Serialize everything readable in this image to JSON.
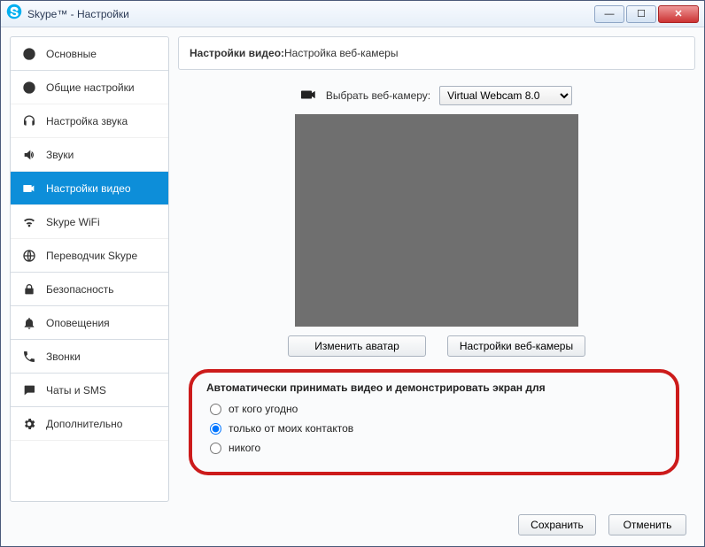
{
  "window": {
    "title": "Skype™ - Настройки"
  },
  "sidebar": {
    "items": [
      {
        "label": "Основные"
      },
      {
        "label": "Общие настройки"
      },
      {
        "label": "Настройка звука"
      },
      {
        "label": "Звуки"
      },
      {
        "label": "Настройки видео"
      },
      {
        "label": "Skype WiFi"
      },
      {
        "label": "Переводчик Skype"
      },
      {
        "label": "Безопасность"
      },
      {
        "label": "Оповещения"
      },
      {
        "label": "Звонки"
      },
      {
        "label": "Чаты и SMS"
      },
      {
        "label": "Дополнительно"
      }
    ]
  },
  "content": {
    "heading_bold": "Настройки видео:",
    "heading_rest": " Настройка веб-камеры",
    "select_label": "Выбрать веб-камеру:",
    "select_value": "Virtual Webcam 8.0",
    "btn_avatar": "Изменить аватар",
    "btn_camsettings": "Настройки веб-камеры",
    "radio_header": "Автоматически принимать видео и демонстрировать экран для",
    "radio_opts": {
      "anyone": "от кого угодно",
      "contacts": "только от моих контактов",
      "none": "никого"
    }
  },
  "footer": {
    "save": "Сохранить",
    "cancel": "Отменить"
  }
}
